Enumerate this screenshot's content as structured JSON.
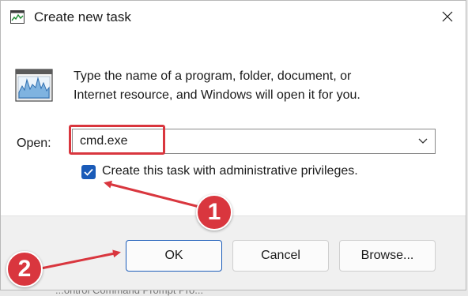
{
  "background": {
    "partial_text": "...ontrol Command Prompt Pro..."
  },
  "dialog": {
    "title": "Create new task",
    "title_icon": "task-manager-icon",
    "close_icon": "close-icon",
    "description_line1": "Type the name of a program, folder, document, or",
    "description_line2": "Internet resource, and Windows will open it for you.",
    "open_label": "Open:",
    "open_value": "cmd.exe",
    "checkbox_label": "Create this task with administrative privileges.",
    "checkbox_checked": true,
    "buttons": {
      "ok": "OK",
      "cancel": "Cancel",
      "browse": "Browse..."
    }
  },
  "annotations": {
    "color": "#d9363e",
    "step1": "1",
    "step2": "2"
  }
}
